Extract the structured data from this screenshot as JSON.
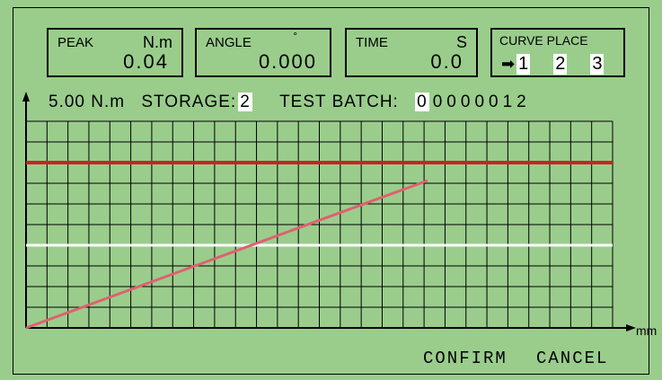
{
  "readouts": {
    "peak": {
      "label": "PEAK",
      "unit": "N.m",
      "value": "0.04"
    },
    "angle": {
      "label": "ANGLE",
      "unit": "°",
      "value": "0.000"
    },
    "time": {
      "label": "TIME",
      "unit": "S",
      "value": "0.0"
    }
  },
  "curve_place": {
    "label": "CURVE PLACE",
    "options": [
      "1",
      "2",
      "3"
    ],
    "selected": "1"
  },
  "info": {
    "range": "5.00 N.m",
    "storage_label": "STORAGE:",
    "storage_value": "2",
    "batch_label": "TEST BATCH:",
    "batch_value": [
      "0",
      "0",
      "0",
      "0",
      "0",
      "0",
      "1",
      "2"
    ]
  },
  "chart": {
    "x_unit": "mm",
    "colors": {
      "background": "#9acd8c",
      "grid": "#000000",
      "upper_limit": "#cc2222",
      "lower_limit": "#ffffff",
      "curve": "#e06070"
    }
  },
  "buttons": {
    "confirm": "CONFIRM",
    "cancel": "CANCEL"
  }
}
